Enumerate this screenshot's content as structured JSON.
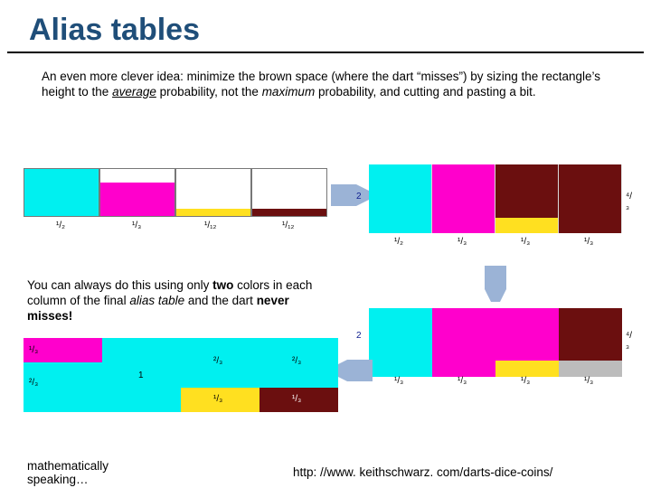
{
  "title": "Alias tables",
  "para1_a": "An even more clever idea: minimize the brown space (where the dart “misses”) by sizing the rectangle’s height to the ",
  "para1_avg": "average",
  "para1_b": " probability, not the ",
  "para1_max": "maximum",
  "para1_c": " probability, and  cutting and pasting a bit.",
  "para2_a": "You can always do this using only ",
  "para2_two": "two",
  "para2_b": " colors in each column of the final ",
  "para2_alias": "alias table",
  "para2_c": " and the dart ",
  "para2_never": "never misses!",
  "bottomtext_a": "mathematically",
  "bottomtext_b": "speaking…",
  "link": "http: //www. keithschwarz. com/darts-dice-coins/",
  "chart_data": [
    {
      "type": "bar",
      "name": "original-histogram",
      "categories": [
        "¹/₂",
        "¹/₃",
        "¹/₁₂",
        "¹/₁₂"
      ],
      "values": [
        0.5,
        0.333,
        0.083,
        0.083
      ],
      "colors": [
        "cyan",
        "magenta",
        "yellow",
        "darkred"
      ],
      "side_label": "2",
      "xlabel": "",
      "ylabel": ""
    },
    {
      "type": "bar",
      "name": "scaled-by-average",
      "xticks": [
        "¹/₂",
        "¹/₃",
        "¹/₃",
        "¹/₃"
      ],
      "slot_top": [
        "brown",
        "brown",
        "brown",
        "brown"
      ],
      "slot_bottom": [
        "cyan",
        "magenta",
        "yellow",
        "darkred"
      ],
      "bottom_heights": [
        1.0,
        1.0,
        0.25,
        0.25
      ],
      "side_label_left": "2",
      "side_label_right": "⁴/₃"
    },
    {
      "type": "bar",
      "name": "alias-step",
      "xticks": [
        "¹/₃",
        "¹/₃",
        "¹/₃",
        "¹/₃"
      ],
      "slot_top": [
        "cyan",
        "brown",
        "magenta",
        "darkred"
      ],
      "slot_bottom": [
        "cyan",
        "magenta",
        "yellow",
        "gray"
      ],
      "top_heights": [
        0.5,
        0.0,
        0.75,
        1.0
      ],
      "side_label_left": "2",
      "side_label_right": "⁴/₃"
    },
    {
      "type": "bar",
      "name": "final-alias-table",
      "xticks": [
        "",
        "",
        "",
        ""
      ],
      "cells": [
        {
          "top_color": "magenta",
          "top_label": "¹/₃",
          "bottom_color": "cyan",
          "bottom_label": "²/₃",
          "top_frac": 0.333
        },
        {
          "top_color": "cyan",
          "top_label": "1",
          "bottom_color": "cyan",
          "bottom_label": "",
          "top_frac": 1.0
        },
        {
          "top_color": "cyan",
          "top_label": "²/₃",
          "bottom_color": "yellow",
          "bottom_label": "¹/₃",
          "top_frac": 0.666
        },
        {
          "top_color": "cyan",
          "top_label": "²/₃",
          "bottom_color": "darkred",
          "bottom_label": "¹/₃",
          "top_frac": 0.666
        }
      ]
    }
  ],
  "ticks": {
    "chA": [
      "¹/₂",
      "¹/₃",
      "¹/₁₂",
      "¹/₁₂"
    ],
    "chB_side_left": "2",
    "chB_side_right": "⁴/₃",
    "chB_ticks": [
      "¹/₂",
      "¹/₃",
      "¹/₃",
      "¹/₃"
    ],
    "chC_side_left": "2",
    "chC_side_right": "⁴/₃",
    "chC_ticks": [
      "¹/₃",
      "¹/₃",
      "¹/₃",
      "¹/₃"
    ],
    "chD_c0_top": "¹/₃",
    "chD_c0_bot": "²/₃",
    "chD_c1": "1",
    "chD_c2_top": "²/₃",
    "chD_c2_bot": "¹/₃",
    "chD_c3_top": "²/₃",
    "chD_c3_bot": "¹/₃"
  }
}
